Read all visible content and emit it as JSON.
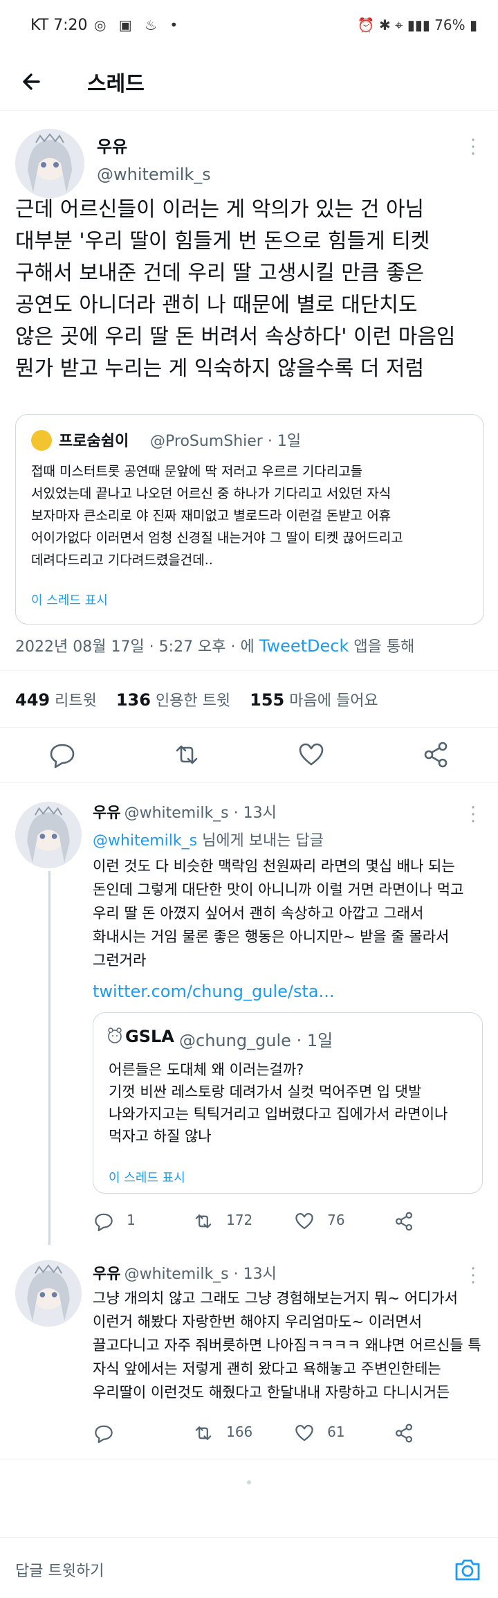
{
  "status_bar": {
    "carrier_time": "KT 7:20",
    "right": "76%"
  },
  "header": {
    "title": "스레드"
  },
  "main_tweet": {
    "name": "우유",
    "handle": "@whitemilk_s",
    "lines": [
      "근데 어르신들이 이러는 게 악의가 있는 건 아님",
      "대부분 '우리 딸이 힘들게 번 돈으로 힘들게 티켓",
      "구해서 보내준 건데 우리 딸 고생시킬 만큼 좋은",
      "공연도 아니더라 괜히 나 때문에 별로 대단치도",
      "않은 곳에 우리 딸 돈 버려서 속상하다' 이런 마음임",
      "뭔가 받고 누리는 게 익숙하지 않을수록 더 저럼"
    ],
    "quote": {
      "name": "프로숨쉼이",
      "handle_time": "@ProSumShier · 1일",
      "lines": [
        "접때 미스터트롯 공연때 문앞에 딱 저러고 우르르 기다리고들",
        "서있었는데 끝나고 나오던 어르신 중 하나가 기다리고 서있던 자식",
        "보자마자 큰소리로 야 진짜 재미없고 별로드라 이런걸 돈받고 어휴",
        "어이가없다 이러면서 엄청 신경질 내는거야 그 딸이 티켓 끊어드리고",
        "데려다드리고 기다려드렸을건데.."
      ],
      "show_thread": "이 스레드 표시"
    },
    "meta_date": "2022년 08월 17일 · 5:27 오후 · 에",
    "meta_source": "TweetDeck",
    "meta_suffix": "앱을 통해",
    "stats": {
      "retweets_count": "449",
      "retweets_label": "리트윗",
      "quotes_count": "136",
      "quotes_label": "인용한 트윗",
      "likes_count": "155",
      "likes_label": "마음에 들어요"
    }
  },
  "reply1": {
    "name": "우유",
    "handle_time": "@whitemilk_s · 13시",
    "reply_to_handle": "@whitemilk_s",
    "reply_to_suffix": "님에게 보내는 답글",
    "lines": [
      "이런 것도 다 비슷한 맥락임 천원짜리 라면의 몇십 배나 되는",
      "돈인데 그렇게 대단한 맛이 아니니까 이럴 거면 라면이나 먹고",
      "우리 딸 돈 아꼈지 싶어서 괜히 속상하고 아깝고 그래서",
      "화내시는 거임 물론 좋은 행동은 아니지만~ 받을 줄 몰라서",
      "그런거라"
    ],
    "link": "twitter.com/chung_gule/sta...",
    "quote": {
      "name": "GSLA",
      "handle_time": "@chung_gule · 1일",
      "lines": [
        "어른들은 도대체 왜 이러는걸까?",
        "기껏 비싼 레스토랑 데려가서 실컷 먹어주면 입 댓발",
        "나와가지고는 틱틱거리고 입버렸다고 집에가서 라면이나",
        "먹자고 하질 않나"
      ],
      "show_thread": "이 스레드 표시"
    },
    "actions": {
      "replies": "1",
      "retweets": "172",
      "likes": "76"
    }
  },
  "reply2": {
    "name": "우유",
    "handle_time": "@whitemilk_s · 13시",
    "lines": [
      "그냥 개의치 않고 그래도 그냥 경험해보는거지 뭐~ 어디가서",
      "이런거 해봤다 자랑한번 해야지 우리엄마도~ 이러면서",
      "끌고다니고 자주 줘버릇하면 나아짐ㅋㅋㅋㅋ 왜냐면 어르신들 특",
      "자식 앞에서는 저렇게 괜히 왔다고 욕해놓고 주변인한테는",
      "우리딸이 이런것도 해줬다고 한달내내 자랑하고 다니시거든"
    ],
    "actions": {
      "retweets": "166",
      "likes": "61"
    }
  },
  "reply_bar": {
    "placeholder": "답글 트윗하기"
  }
}
